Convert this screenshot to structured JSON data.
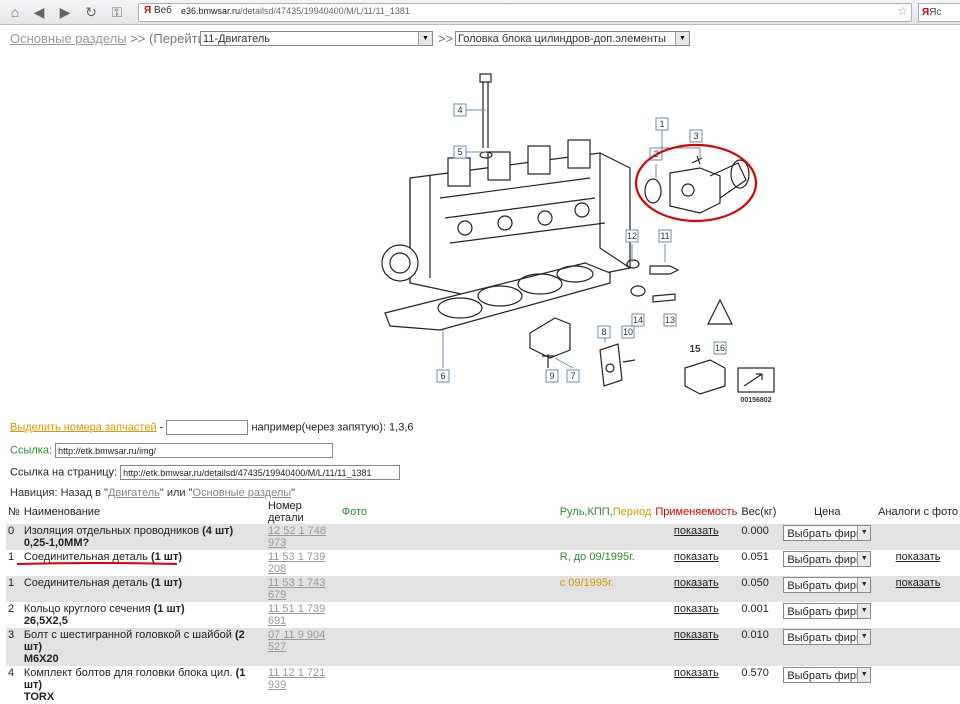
{
  "browser": {
    "url_prefix": "Веб",
    "url_host": "e36.bmwsar.ru",
    "url_path": "/detailsd/47435/19940400/M/L/11/11_1381",
    "search_text": "Яс"
  },
  "breadcrumb": {
    "sections": "Основные разделы",
    "sep1": ">>",
    "goto": "(Перейти)",
    "group_select": "11-Двигатель",
    "sep2": ">>",
    "subgroup_select": "Головка блока цилиндров-доп.элементы"
  },
  "diagram": {
    "callouts": [
      "1",
      "2",
      "3",
      "4",
      "5",
      "6",
      "7",
      "8",
      "9",
      "10",
      "11",
      "12",
      "13",
      "14",
      "15",
      "16"
    ],
    "image_number": "00156802"
  },
  "form": {
    "highlight_link": "Выделить номера запчастей",
    "dash": "-",
    "example": "например(через запятую): 1,3,6",
    "link_label": "Ссылка:",
    "link_value": "http://etk.bmwsar.ru/img/",
    "page_link_label": "Ссылка на страницу:",
    "page_link_value": "http://etk.bmwsar.ru/detailsd/47435/19940400/M/L/11/11_1381"
  },
  "nav": {
    "prefix": "Навиция: Назад в \"",
    "engine": "Двигатель",
    "mid": "\" или \"",
    "sections": "Основные разделы",
    "suffix": "\""
  },
  "table": {
    "headers": {
      "num": "№",
      "name": "Наименование",
      "part": "Номер детали",
      "photo": "Фото",
      "rul": "Руль,КПП,",
      "period": "Период",
      "apply": "Применяемость",
      "weight": "Вес(кг)",
      "price": "Цена",
      "analogs": "Аналоги с фото"
    },
    "rows": [
      {
        "n": "0",
        "name": "Изоляция отдельных проводников",
        "qty": "(4 шт)",
        "sub": "0,25-1,0MM?",
        "part": "12 52 1 748 973",
        "rul": "",
        "rul_class": "",
        "apply": "показать",
        "weight": "0.000",
        "price": "Выбрать фирму",
        "analog": ""
      },
      {
        "n": "1",
        "name": "Соединительная деталь",
        "qty": "(1 шт)",
        "sub": "",
        "part": "11 53 1 739 208",
        "rul": "R, до 09/1995г.",
        "rul_class": "r-green",
        "apply": "показать",
        "weight": "0.051",
        "price": "Выбрать фирму",
        "analog": "показать"
      },
      {
        "n": "1",
        "name": "Соединительная деталь",
        "qty": "(1 шт)",
        "sub": "",
        "part": "11 53 1 743 679",
        "rul": "с 09/1995г.",
        "rul_class": "r-orange",
        "apply": "показать",
        "weight": "0.050",
        "price": "Выбрать фирму",
        "analog": "показать"
      },
      {
        "n": "2",
        "name": "Кольцо круглого сечения",
        "qty": "(1 шт)",
        "sub": "26,5X2,5",
        "part": "11 51 1 739 691",
        "rul": "",
        "rul_class": "",
        "apply": "показать",
        "weight": "0.001",
        "price": "Выбрать фирму",
        "analog": ""
      },
      {
        "n": "3",
        "name": "Болт с шестигранной головкой с шайбой",
        "qty": "(2 шт)",
        "sub": "M6X20",
        "part": "07 11 9 904 527",
        "rul": "",
        "rul_class": "",
        "apply": "показать",
        "weight": "0.010",
        "price": "Выбрать фирму",
        "analog": ""
      },
      {
        "n": "4",
        "name": "Комплект болтов для головки блока цил.",
        "qty": "(1 шт)",
        "sub": "TORX",
        "part": "11 12 1 721 939",
        "rul": "",
        "rul_class": "",
        "apply": "показать",
        "weight": "0.570",
        "price": "Выбрать фирму",
        "analog": ""
      }
    ]
  }
}
